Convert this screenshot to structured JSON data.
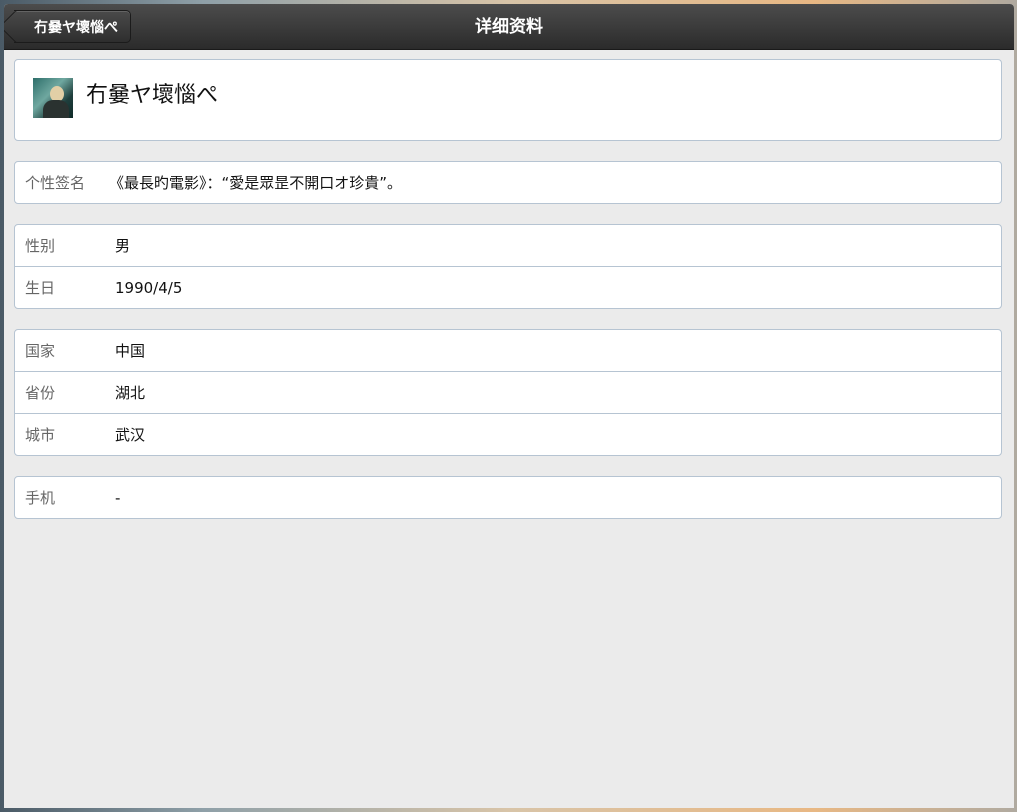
{
  "navbar": {
    "back_label": "冇嘦ヤ壞惱ぺ",
    "title": "详细资料"
  },
  "profile": {
    "name": "冇嘦ヤ壞惱ぺ"
  },
  "signature": {
    "label": "个性签名",
    "value": "《最長旳電影》：“愛是眾昰不開口オ珍貴”。"
  },
  "personal": [
    {
      "label": "性别",
      "value": "男"
    },
    {
      "label": "生日",
      "value": "1990/4/5"
    }
  ],
  "location": [
    {
      "label": "国家",
      "value": "中国"
    },
    {
      "label": "省份",
      "value": "湖北"
    },
    {
      "label": "城市",
      "value": "武汉"
    }
  ],
  "contact": [
    {
      "label": "手机",
      "value": "-"
    }
  ],
  "colors": {
    "navbar_top": "#4c4c4c",
    "navbar_bottom": "#2b2b2b",
    "page_background": "#ebebeb",
    "card_border": "#b6c4d2"
  }
}
